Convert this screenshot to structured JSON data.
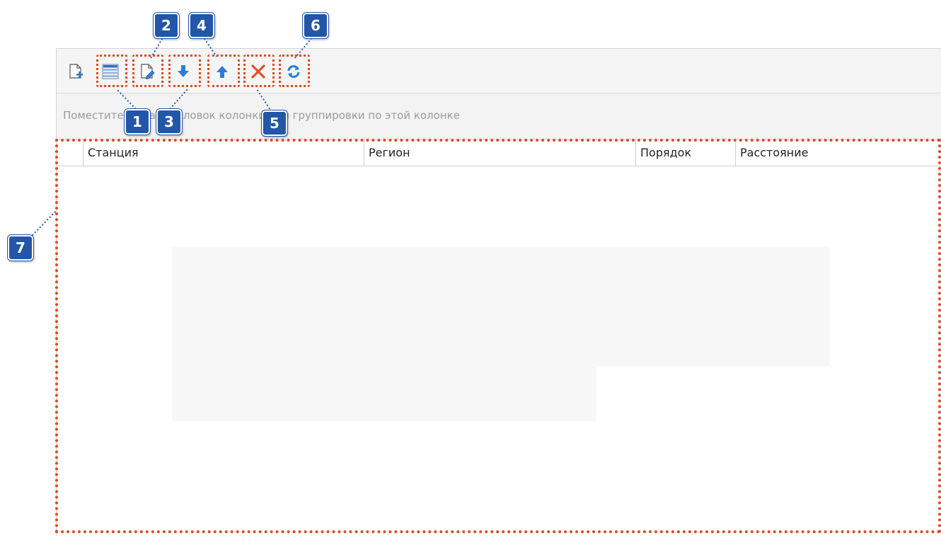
{
  "toolbar": {
    "buttons": [
      {
        "icon": "new-document-icon"
      },
      {
        "icon": "grid-rows-icon"
      },
      {
        "icon": "edit-document-icon"
      },
      {
        "icon": "arrow-down-icon"
      },
      {
        "icon": "arrow-up-icon"
      },
      {
        "icon": "delete-icon"
      },
      {
        "icon": "refresh-icon"
      }
    ]
  },
  "group_panel": {
    "text": "Поместите сюда заголовок колонки для группировки по этой колонке"
  },
  "grid": {
    "columns": [
      "Станция",
      "Регион",
      "Порядок",
      "Расстояние"
    ],
    "rows": []
  },
  "callouts": {
    "b1": "1",
    "b2": "2",
    "b3": "3",
    "b4": "4",
    "b5": "5",
    "b6": "6",
    "b7": "7"
  },
  "colors": {
    "badge": "#2356a8",
    "highlight": "#e8461e",
    "connector": "#2356a8"
  }
}
